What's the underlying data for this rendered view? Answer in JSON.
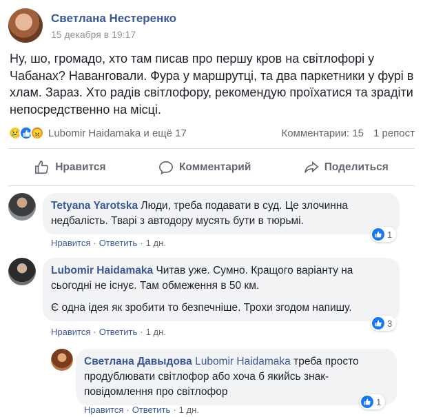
{
  "post": {
    "author": "Светлана Нестеренко",
    "date": "15 декабря в 19:17",
    "text": "Ну, шо, громадо, хто там писав про першу кров на світлофорі у Чабанах? Наванговали. Фура у маршрутці, та два паркетники у фурі в хлам. Зараз. Хто радів світлофору, рекомендую проїхатися та зрадіти непосредственно на місці.",
    "reactions": {
      "icons": [
        "sad-icon",
        "like-icon",
        "angry-icon"
      ],
      "names": "Lubomir Haidamaka и ещё 17"
    },
    "comments_count": "Комментарии: 15",
    "shares_count": "1 репост"
  },
  "actions": {
    "like": "Нравится",
    "comment": "Комментарий",
    "share": "Поделиться"
  },
  "comments": [
    {
      "author": "Tetyana Yarotska",
      "text": "Люди, треба подавати в суд. Це злочинна недбалість. Тварі з автодору мусять бути в тюрьмі.",
      "like": "Нравится",
      "reply": "Ответить",
      "time": "1 дн.",
      "likes": "1"
    },
    {
      "author": "Lubomir Haidamaka",
      "text": "Читав уже. Сумно. Кращого варіанту на сьогодні не існує. Там обмеження в 50 км.",
      "text2": "Є одна ідея як зробити то безпечніше. Трохи згодом напишу.",
      "like": "Нравится",
      "reply": "Ответить",
      "time": "1 дн.",
      "likes": "3"
    },
    {
      "author": "Светлана Давыдова",
      "mention": "Lubomir Haidamaka",
      "text": " треба просто продублювати світлофор або хоча б якийсь знак-повідомлення про світлофор",
      "like": "Нравится",
      "reply": "Ответить",
      "time": "1 дн.",
      "likes": "1"
    }
  ],
  "colors": {
    "link": "#385898",
    "meta": "#90949c",
    "bubble": "#f2f3f5",
    "like_blue": "#1877f2"
  }
}
